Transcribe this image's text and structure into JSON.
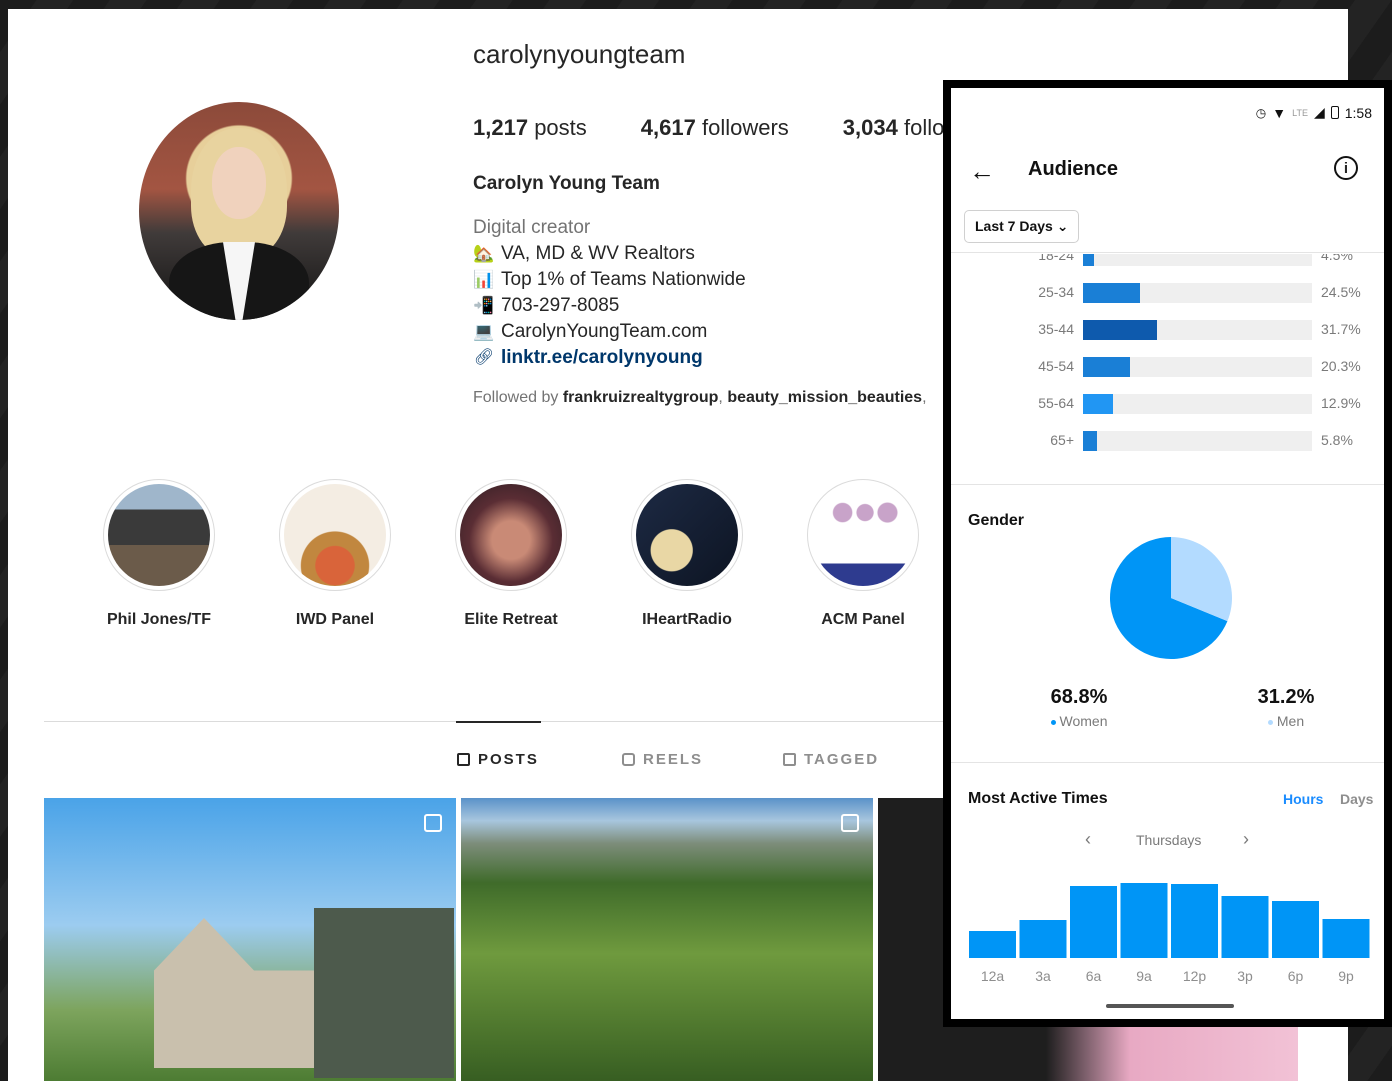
{
  "profile": {
    "username": "carolynyoungteam",
    "posts_count": "1,217",
    "posts_label": "posts",
    "followers_count": "4,617",
    "followers_label": "followers",
    "following_count": "3,034",
    "following_label": "follo",
    "full_name": "Carolyn Young Team",
    "category": "Digital creator",
    "bio_lines": [
      {
        "icon": "house-icon",
        "emoji": "🏡",
        "text": "VA, MD & WV Realtors"
      },
      {
        "icon": "chart-icon",
        "emoji": "📊",
        "text": "Top 1% of Teams Nationwide"
      },
      {
        "icon": "phone-icon",
        "emoji": "📲",
        "text": "703-297-8085"
      },
      {
        "icon": "laptop-icon",
        "emoji": "💻",
        "text": "CarolynYoungTeam.com"
      }
    ],
    "link": "linktr.ee/carolynyoung",
    "followed_by_prefix": "Followed by",
    "followed_by_1": "frankruizrealtygroup",
    "followed_by_2": "beauty_mission_beauties",
    "followed_by_sep": ", "
  },
  "highlights": [
    {
      "label": "Phil Jones/TF"
    },
    {
      "label": "IWD Panel"
    },
    {
      "label": "Elite Retreat"
    },
    {
      "label": "IHeartRadio"
    },
    {
      "label": "ACM Panel"
    }
  ],
  "tabs": {
    "posts": "POSTS",
    "reels": "REELS",
    "tagged": "TAGGED"
  },
  "audience": {
    "status_time": "1:58",
    "status_lte": "LTE",
    "title": "Audience",
    "range_label": "Last 7 Days",
    "age_ranges": [
      {
        "label": "18-24",
        "value": 4.5,
        "pct": "4.5%"
      },
      {
        "label": "25-34",
        "value": 24.5,
        "pct": "24.5%"
      },
      {
        "label": "35-44",
        "value": 31.7,
        "pct": "31.7%"
      },
      {
        "label": "45-54",
        "value": 20.3,
        "pct": "20.3%"
      },
      {
        "label": "55-64",
        "value": 12.9,
        "pct": "12.9%"
      },
      {
        "label": "65+",
        "value": 5.8,
        "pct": "5.8%"
      }
    ],
    "age_colors": [
      "#1a7fd6",
      "#1a7fd6",
      "#0e5aad",
      "#1a7fd6",
      "#2196f3",
      "#1a7fd6"
    ],
    "gender_title": "Gender",
    "women_value": "68.8%",
    "women_label": "Women",
    "men_value": "31.2%",
    "men_label": "Men",
    "women_color": "#0095f6",
    "men_color": "#b3dbff",
    "active_title": "Most Active Times",
    "hours_label": "Hours",
    "days_label": "Days",
    "day_label": "Thursdays"
  },
  "chart_data": {
    "type": "bar",
    "categories": [
      "12a",
      "3a",
      "6a",
      "9a",
      "12p",
      "3p",
      "6p",
      "9p"
    ],
    "values": [
      27,
      38,
      72,
      75,
      74,
      62,
      57,
      39
    ],
    "ylim": [
      0,
      100
    ],
    "color": "#0095f6"
  }
}
